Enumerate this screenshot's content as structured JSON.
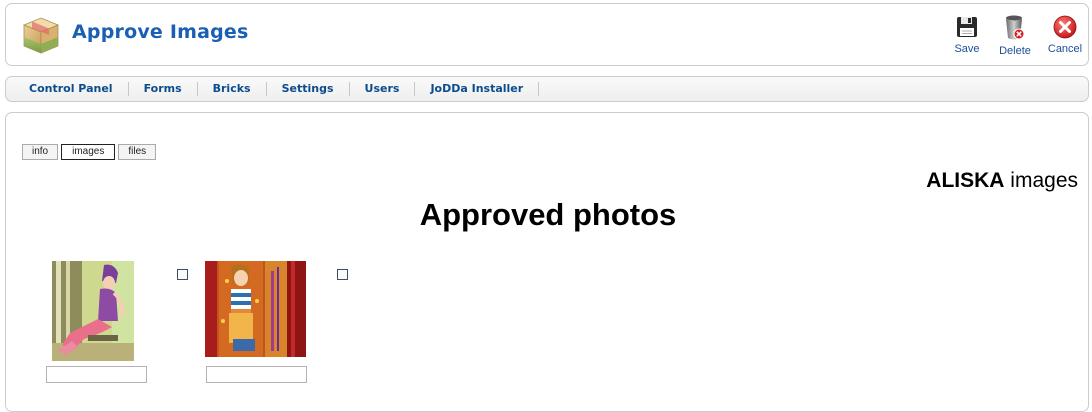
{
  "header": {
    "title": "Approve Images",
    "logo_icon": "package-box-icon",
    "toolbar": [
      {
        "label": "Save",
        "icon": "floppy-disk-icon"
      },
      {
        "label": "Delete",
        "icon": "trash-bin-icon"
      },
      {
        "label": "Cancel",
        "icon": "cancel-x-icon"
      }
    ]
  },
  "menu": {
    "items": [
      "Control Panel",
      "Forms",
      "Bricks",
      "Settings",
      "Users",
      "JoDDa Installer"
    ]
  },
  "tabs": {
    "items": [
      "info",
      "images",
      "files"
    ],
    "active": "images"
  },
  "user": {
    "name": "ALISKA",
    "suffix": "images"
  },
  "section": {
    "title": "Approved photos"
  },
  "photos": [
    {
      "image": "girl-purple-hat-sitting-photo",
      "caption": "",
      "checked": false
    },
    {
      "image": "girl-striped-top-red-background-photo",
      "caption": "",
      "checked": false
    }
  ],
  "colors": {
    "title_blue": "#1a5fb4",
    "menu_link": "#0b4c8c",
    "toolbar_label": "#1d4e9a",
    "panel_border": "#cccccc"
  }
}
